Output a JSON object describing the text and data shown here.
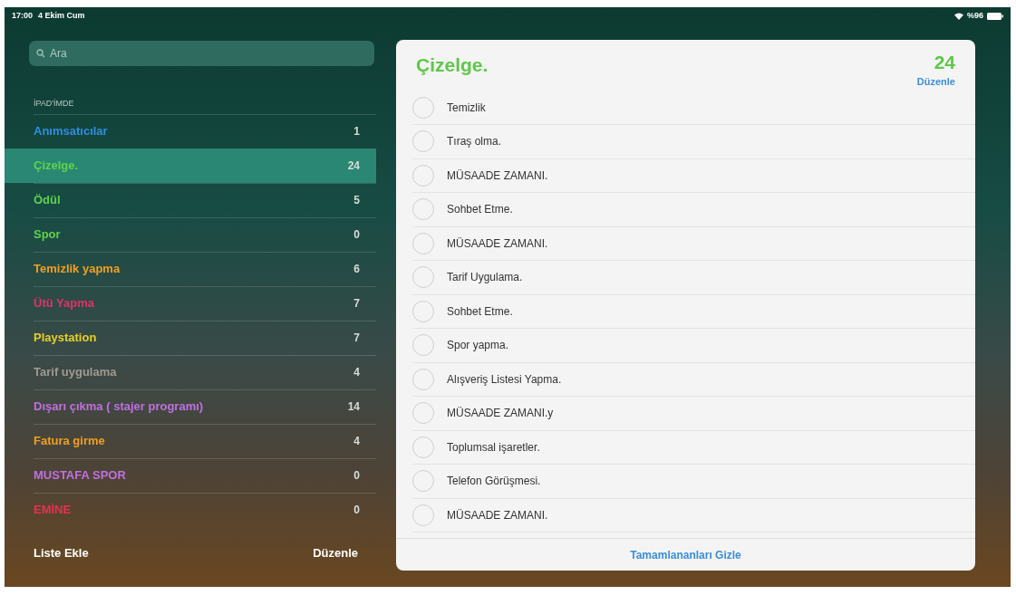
{
  "status_bar": {
    "time": "17:00",
    "date": "4 Ekim Cum",
    "battery_text": "%96"
  },
  "sidebar": {
    "search": {
      "placeholder": "Ara"
    },
    "section_title": "İPAD'İMDE",
    "lists": [
      {
        "name": "Anımsatıcılar",
        "count": "1",
        "color": "#2f8fe0",
        "selected": false
      },
      {
        "name": "Çizelge.",
        "count": "24",
        "color": "#5ed34a",
        "selected": true
      },
      {
        "name": "Ödül",
        "count": "5",
        "color": "#5ed34a",
        "selected": false
      },
      {
        "name": "Spor",
        "count": "0",
        "color": "#5ed34a",
        "selected": false
      },
      {
        "name": "Temizlik yapma",
        "count": "6",
        "color": "#f0a020",
        "selected": false
      },
      {
        "name": "Ütü Yapma",
        "count": "7",
        "color": "#e0306a",
        "selected": false
      },
      {
        "name": "Playstation",
        "count": "7",
        "color": "#e8d020",
        "selected": false
      },
      {
        "name": "Tarif uygulama",
        "count": "4",
        "color": "#a09a90",
        "selected": false
      },
      {
        "name": "Dışarı çıkma ( stajer programı)",
        "count": "14",
        "color": "#c070e0",
        "selected": false
      },
      {
        "name": "Fatura girme",
        "count": "4",
        "color": "#f0a020",
        "selected": false
      },
      {
        "name": "MUSTAFA SPOR",
        "count": "0",
        "color": "#c070e0",
        "selected": false
      },
      {
        "name": "EMİNE",
        "count": "0",
        "color": "#e83050",
        "selected": false
      }
    ],
    "footer": {
      "add_label": "Liste Ekle",
      "edit_label": "Düzenle"
    }
  },
  "detail": {
    "title": "Çizelge.",
    "count": "24",
    "edit_label": "Düzenle",
    "items": [
      {
        "text": "Temizlik",
        "checked": false
      },
      {
        "text": "Tıraş olma.",
        "checked": false
      },
      {
        "text": "MÜSAADE ZAMANI.",
        "checked": false
      },
      {
        "text": "Sohbet Etme.",
        "checked": false
      },
      {
        "text": "MÜSAADE ZAMANI.",
        "checked": false
      },
      {
        "text": "Tarif Uygulama.",
        "checked": false
      },
      {
        "text": "Sohbet Etme.",
        "checked": false
      },
      {
        "text": "Spor yapma.",
        "checked": false
      },
      {
        "text": "Alışveriş Listesi Yapma.",
        "checked": false
      },
      {
        "text": "MÜSAADE ZAMANI.y",
        "checked": false
      },
      {
        "text": "Toplumsal işaretler.",
        "checked": false
      },
      {
        "text": "Telefon Görüşmesi.",
        "checked": false
      },
      {
        "text": "MÜSAADE ZAMANI.",
        "checked": false
      }
    ],
    "hide_completed_label": "Tamamlananları Gizle"
  }
}
